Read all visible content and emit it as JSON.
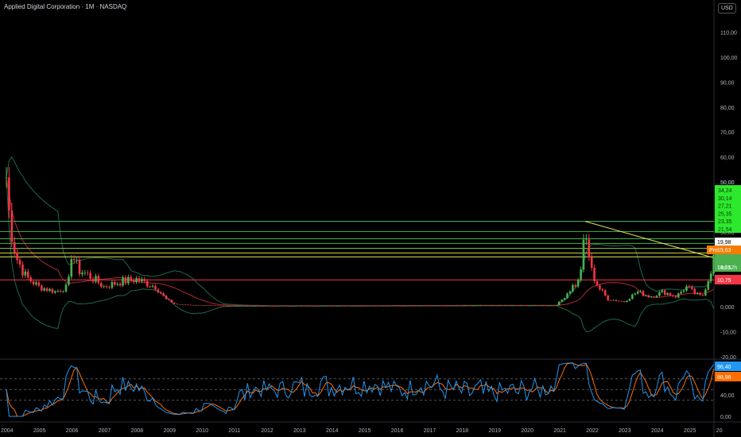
{
  "header": {
    "title": "Applied Digital Corporation · 1M · NASDAQ",
    "currency": "USD"
  },
  "chart_data": {
    "type": "candlestick",
    "title": "Applied Digital Corporation · 1M · NASDAQ",
    "ylim": [
      -20,
      115
    ],
    "y_ticks": [
      "110,00",
      "100,00",
      "90,00",
      "80,00",
      "70,00",
      "60,00",
      "50,00",
      "40,00",
      "30,00",
      "20,00",
      "10,00",
      "0,000",
      "-10,00",
      "-20,00"
    ],
    "y_tick_values": [
      110,
      100,
      90,
      80,
      70,
      60,
      50,
      40,
      30,
      20,
      10,
      0,
      -10,
      -20
    ],
    "x_ticks": [
      "2004",
      "2005",
      "2006",
      "2007",
      "2008",
      "2009",
      "2010",
      "2011",
      "2012",
      "2013",
      "2014",
      "2015",
      "2016",
      "2017",
      "2018",
      "2019",
      "2020",
      "2021",
      "2022",
      "2023",
      "2024",
      "2025",
      "20"
    ],
    "price_keypoints": [
      [
        2004.0,
        52
      ],
      [
        2004.1,
        35
      ],
      [
        2004.3,
        20
      ],
      [
        2004.6,
        12
      ],
      [
        2005.0,
        8
      ],
      [
        2005.5,
        6
      ],
      [
        2005.9,
        8
      ],
      [
        2006.0,
        22
      ],
      [
        2006.2,
        15
      ],
      [
        2006.6,
        12
      ],
      [
        2007.0,
        8
      ],
      [
        2007.5,
        10
      ],
      [
        2008.0,
        11
      ],
      [
        2008.6,
        8
      ],
      [
        2008.9,
        3
      ],
      [
        2009.2,
        1
      ],
      [
        2010.0,
        0.5
      ],
      [
        2011.0,
        0.3
      ],
      [
        2020.9,
        0.5
      ],
      [
        2021.1,
        3
      ],
      [
        2021.4,
        8
      ],
      [
        2021.6,
        10
      ],
      [
        2021.8,
        28
      ],
      [
        2021.9,
        22
      ],
      [
        2022.0,
        14
      ],
      [
        2022.2,
        8
      ],
      [
        2022.5,
        3
      ],
      [
        2023.0,
        2
      ],
      [
        2023.4,
        6
      ],
      [
        2023.8,
        4
      ],
      [
        2024.2,
        6
      ],
      [
        2024.6,
        4
      ],
      [
        2024.9,
        8
      ],
      [
        2025.2,
        5
      ],
      [
        2025.4,
        4
      ],
      [
        2025.6,
        12
      ],
      [
        2025.75,
        19.35
      ]
    ],
    "levels": [
      {
        "value": 34.24,
        "label": "34,24",
        "color": "#4caf50"
      },
      {
        "value": 30.14,
        "label": "30,14",
        "color": "#4caf50"
      },
      {
        "value": 27.21,
        "label": "27,21",
        "color": "#4caf50"
      },
      {
        "value": 25.35,
        "label": "25,35",
        "color": "#4caf50"
      },
      {
        "value": 23.35,
        "label": "23,35",
        "color": "#8bc34a"
      },
      {
        "value": 21.54,
        "label": "21,54",
        "color": "#cddc39"
      },
      {
        "value": 10.75,
        "label": "10,75",
        "color": "#f23645"
      }
    ],
    "price_labels": {
      "high_level": "19,98",
      "pre_tag": "Pre",
      "pre_price": "19,63",
      "last_price": "19,35",
      "countdown": "14d 12h",
      "axis_top_label": "50,00"
    },
    "rsi": {
      "y_ticks": [
        "40,00",
        "0,00"
      ],
      "y_tick_values": [
        40,
        0
      ],
      "rsi_value": "96,40",
      "signal_value": "88,98",
      "levels": [
        70,
        50,
        30
      ]
    },
    "colors": {
      "up": "#4caf50",
      "down": "#f23645",
      "band": "#1b6b4a",
      "ma": "#b22833",
      "trend": "#e8e85a",
      "rsi": "#2196f3",
      "signal": "#ff6d00"
    }
  }
}
